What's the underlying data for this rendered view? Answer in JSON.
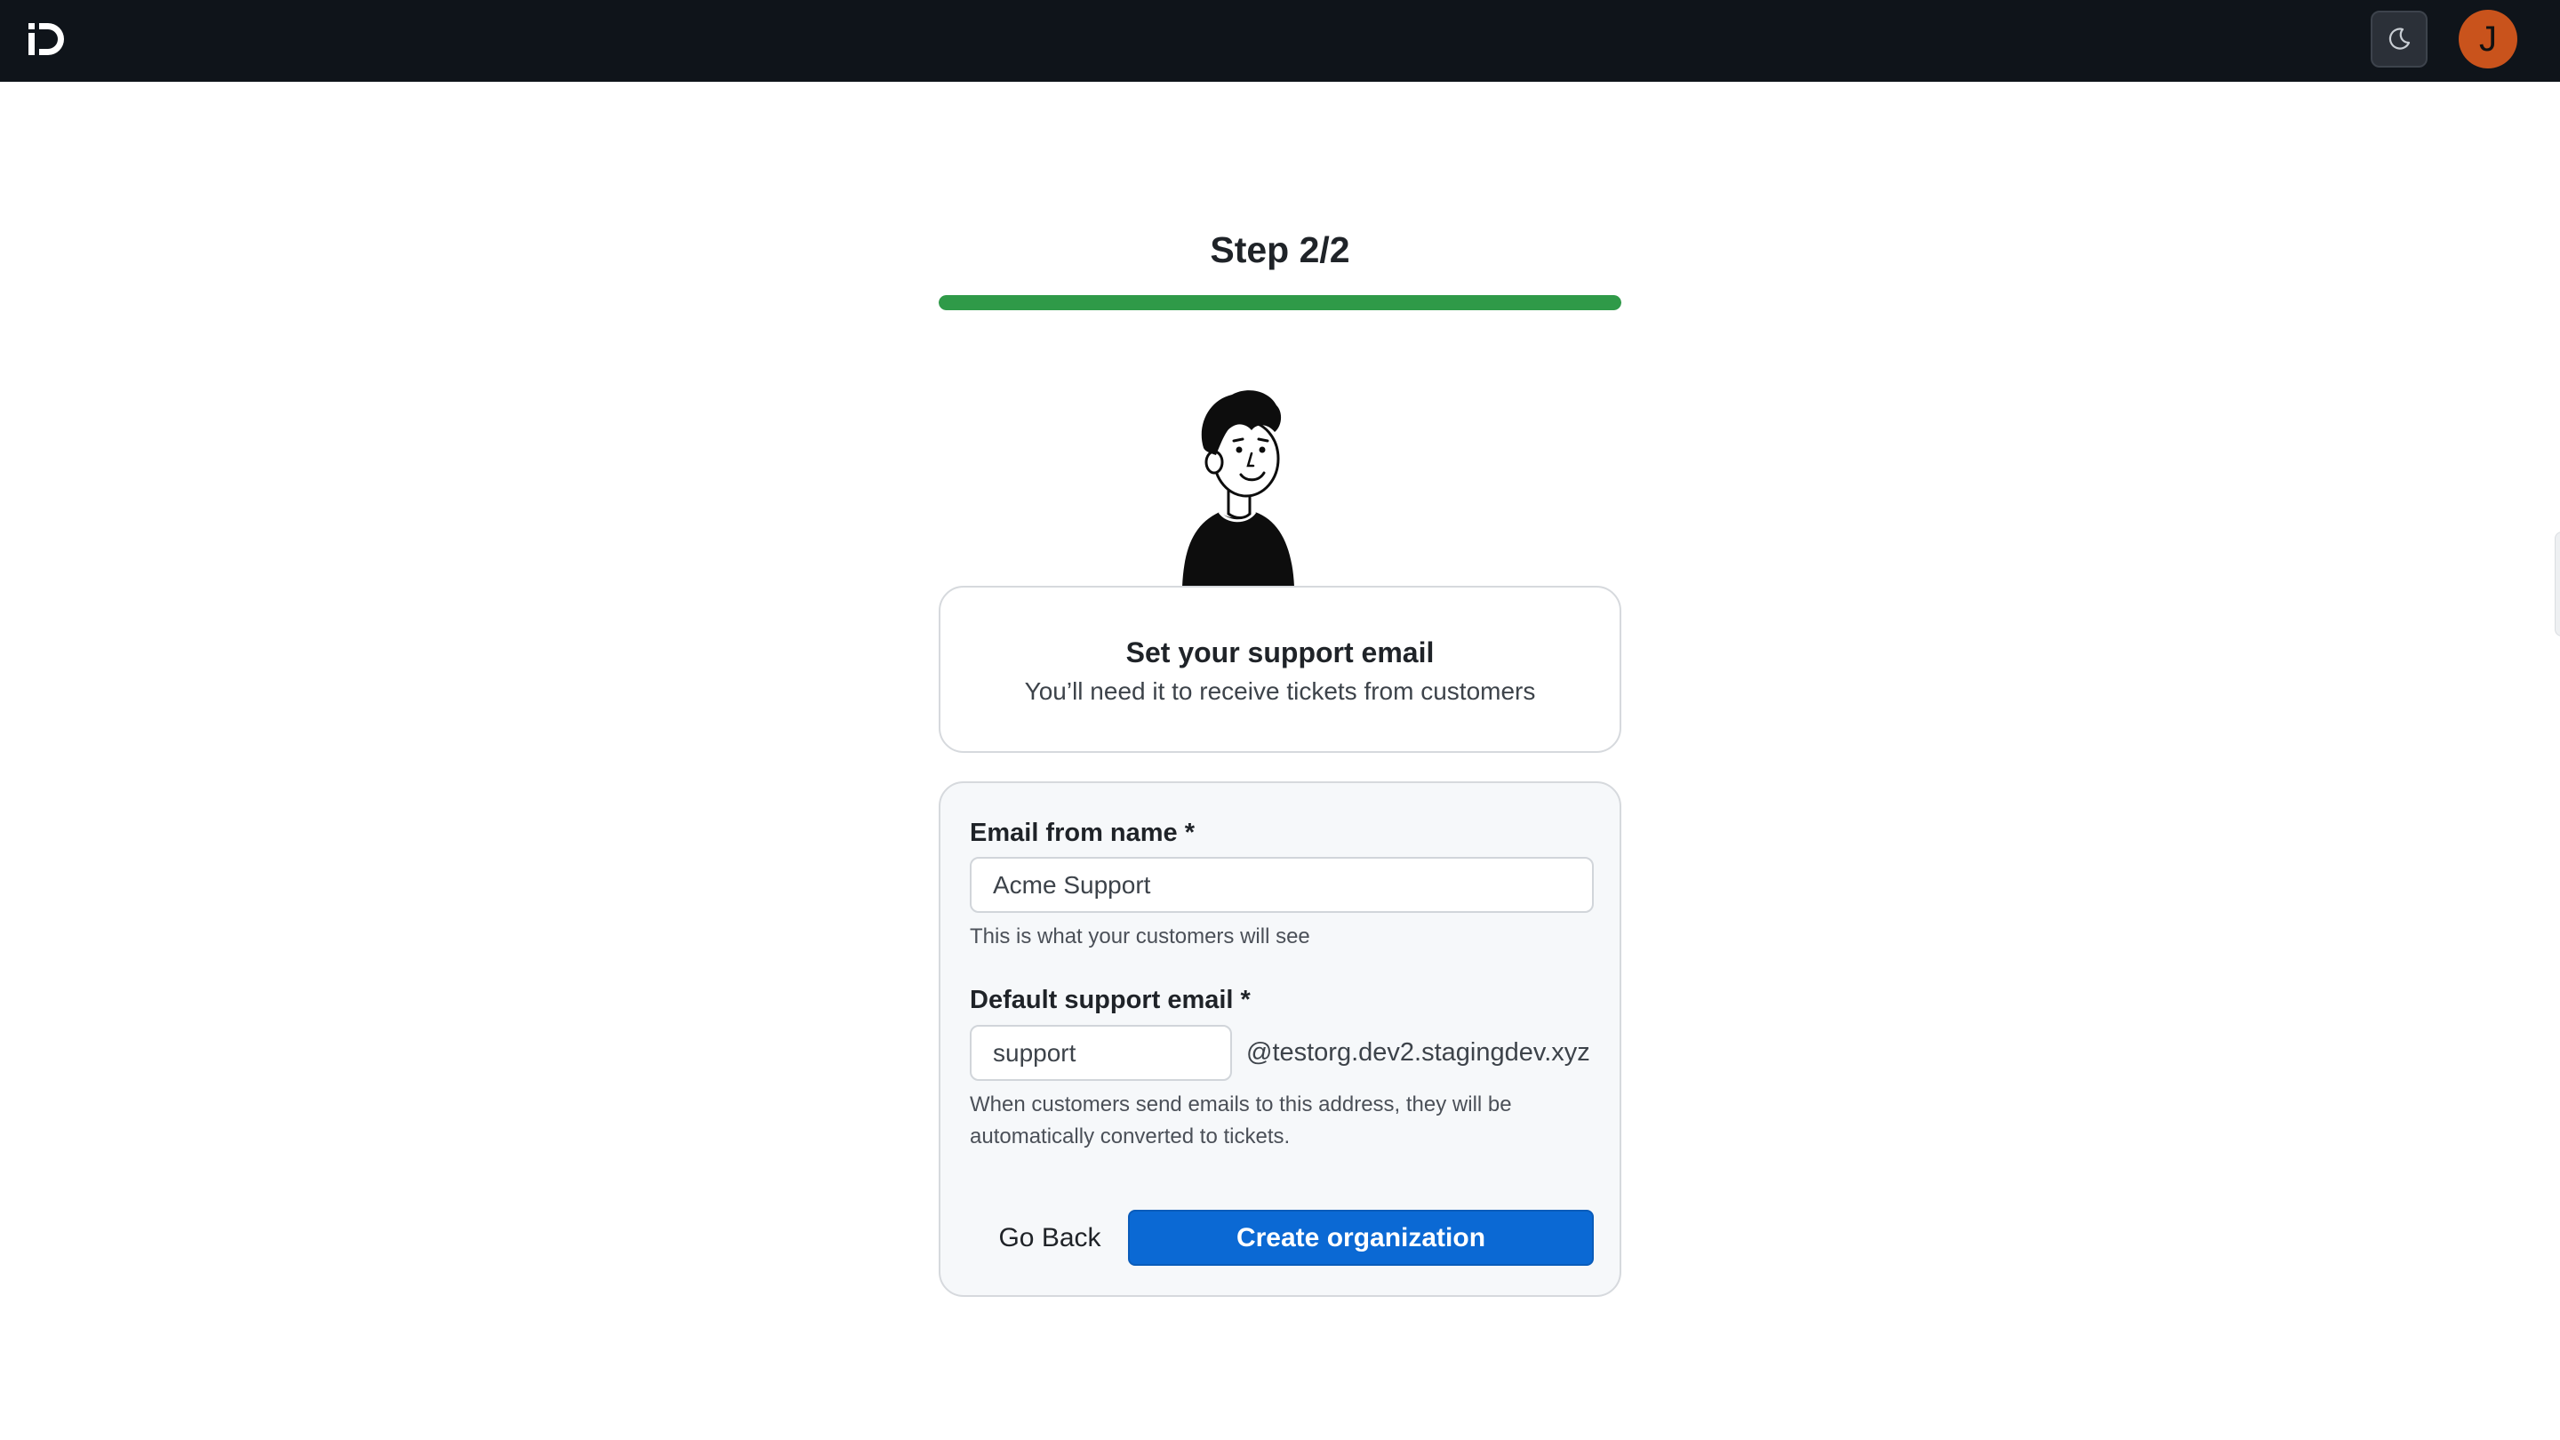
{
  "header": {
    "logo": "support-app-logo",
    "theme_toggle_icon": "moon-icon",
    "avatar_initial": "J",
    "avatar_color": "#c9531c"
  },
  "onboarding": {
    "step_label": "Step 2/2",
    "progress_fraction": 1.0,
    "progress_color": "#2f9a48",
    "illustration": "person-illustration",
    "intro": {
      "title": "Set your support email",
      "subtitle": "You’ll need it to receive tickets from customers"
    }
  },
  "form": {
    "from_name": {
      "label": "Email from name *",
      "value": "Acme Support",
      "hint": "This is what your customers will see"
    },
    "support_email": {
      "label": "Default support email *",
      "value": "support",
      "domain_suffix": "@testorg.dev2.stagingdev.xyz",
      "hint_line1": "When customers send emails to this address, they will be",
      "hint_line2": "automatically converted to tickets."
    },
    "back_label": "Go Back",
    "submit_label": "Create organization",
    "primary_color": "#0b69d4"
  }
}
